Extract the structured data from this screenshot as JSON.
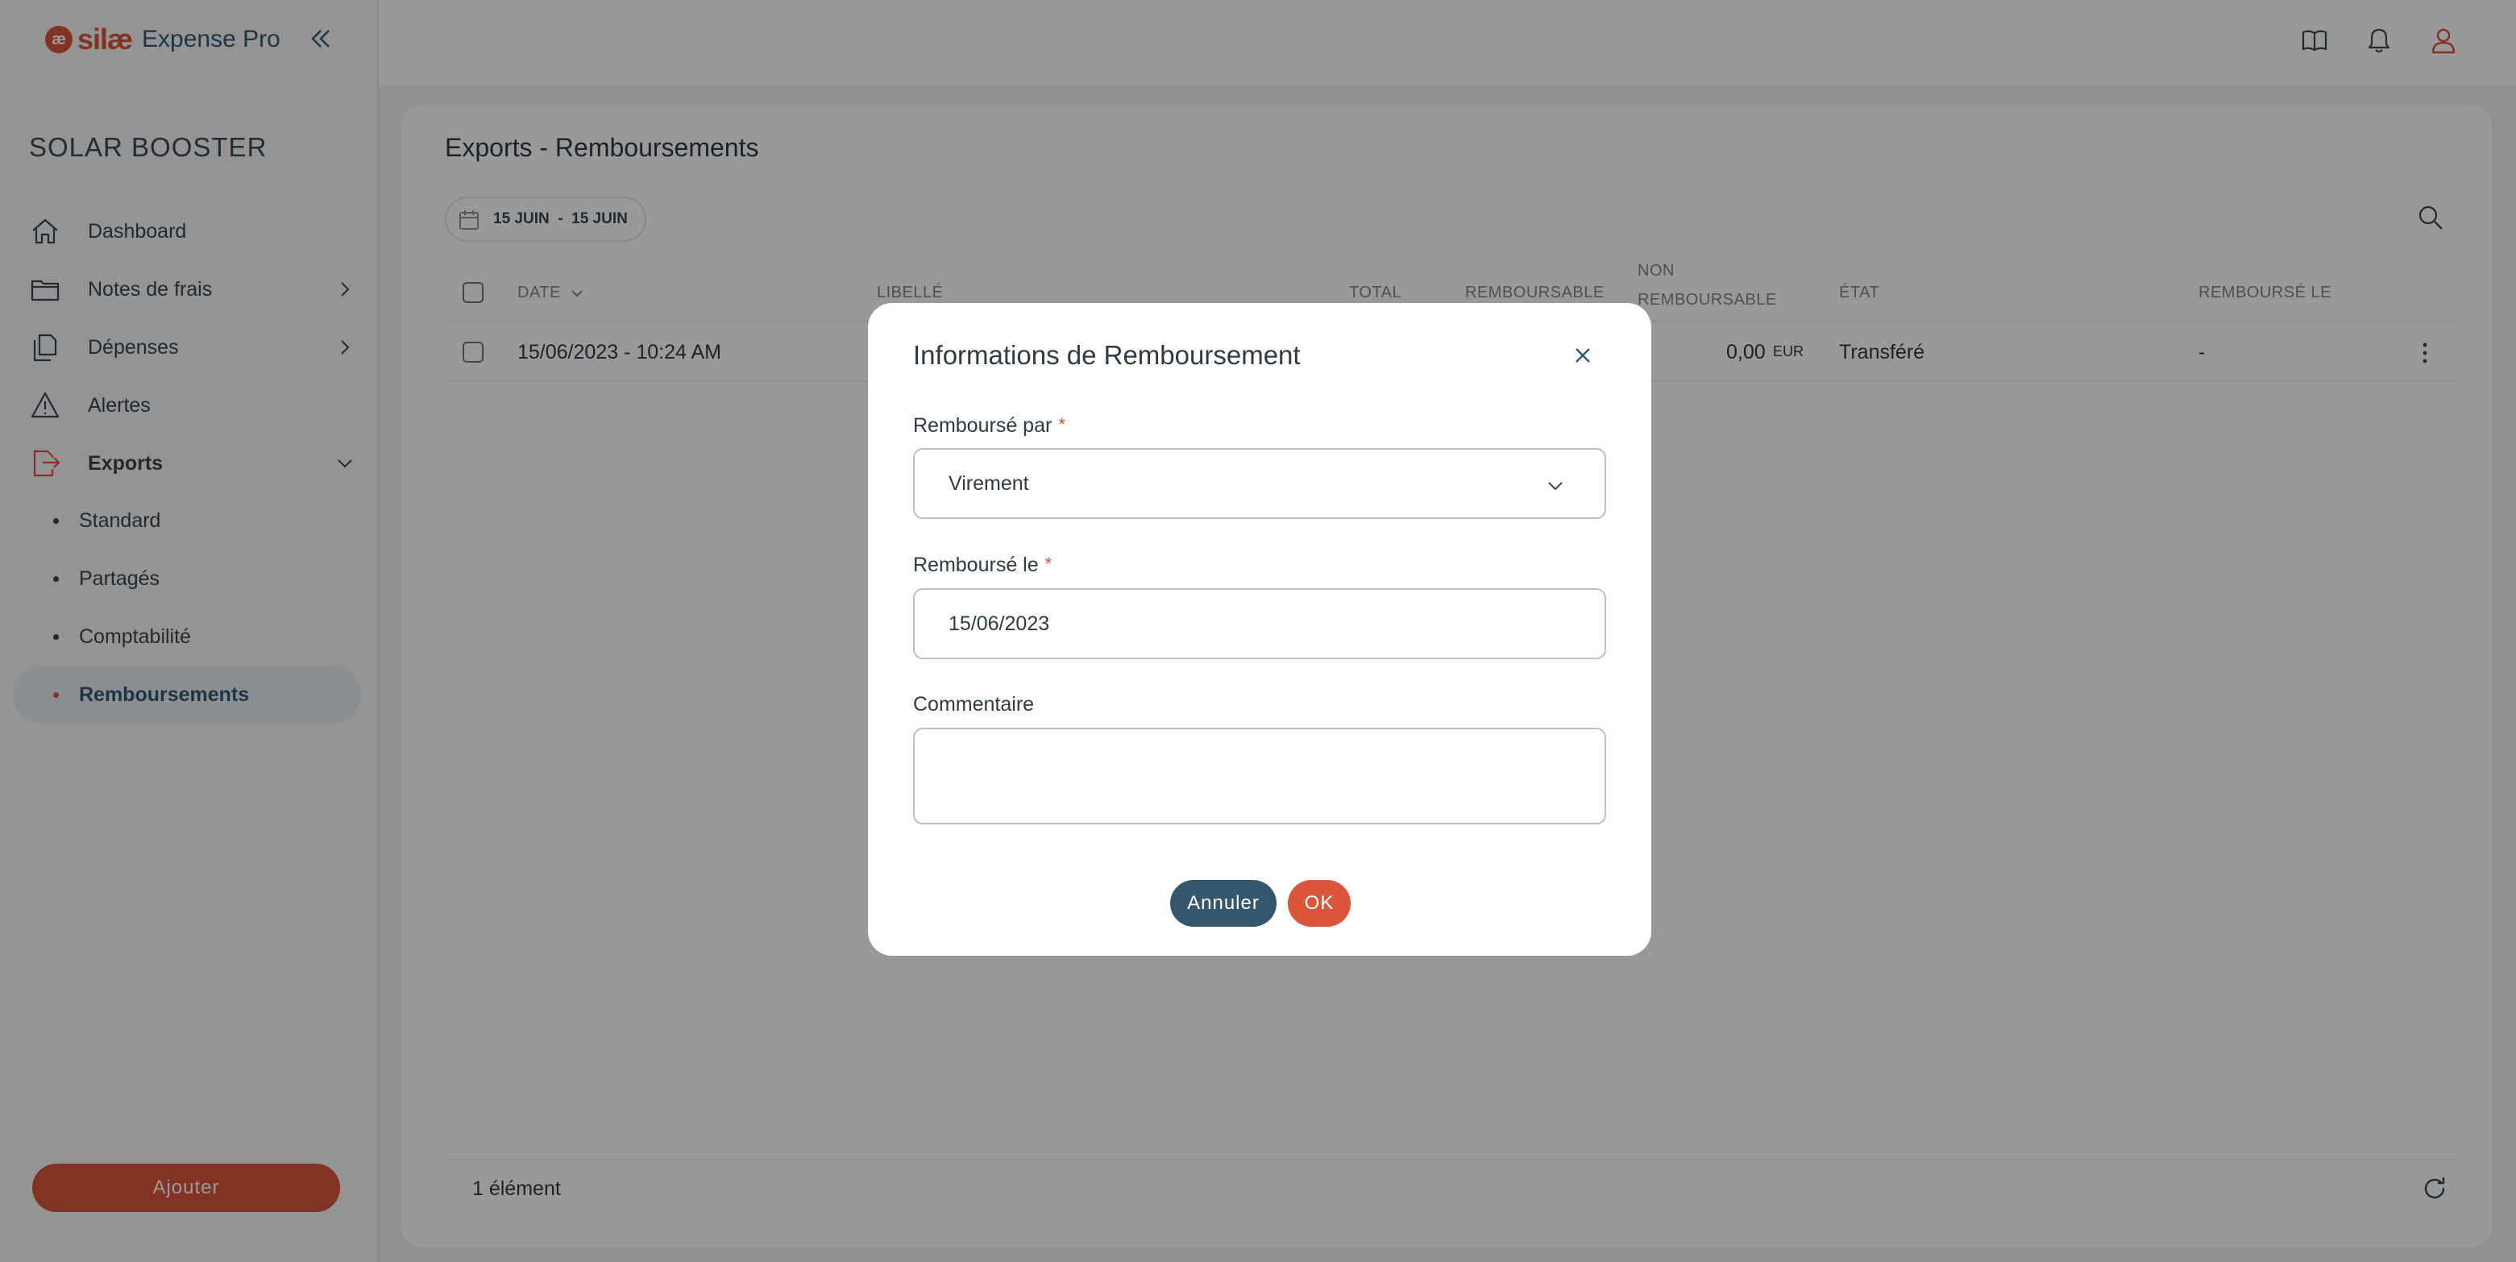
{
  "app": {
    "brand": "silæ",
    "brand_mark": "æ",
    "product": "Expense Pro",
    "company": "SOLAR BOOSTER"
  },
  "sidebar": {
    "items": [
      {
        "label": "Dashboard",
        "icon": "home-icon"
      },
      {
        "label": "Notes de frais",
        "icon": "folder-icon"
      },
      {
        "label": "Dépenses",
        "icon": "documents-icon"
      },
      {
        "label": "Alertes",
        "icon": "warning-icon"
      },
      {
        "label": "Exports",
        "icon": "export-icon"
      }
    ],
    "export_subitems": [
      {
        "label": "Standard"
      },
      {
        "label": "Partagés"
      },
      {
        "label": "Comptabilité"
      },
      {
        "label": "Remboursements"
      }
    ],
    "add_label": "Ajouter"
  },
  "page": {
    "title": "Exports - Remboursements",
    "date_filter": "15 JUIN  -  15 JUIN"
  },
  "table": {
    "headers": {
      "date": "DATE",
      "libelle": "LIBELLÉ",
      "total": "TOTAL",
      "remboursable": "REMBOURSABLE",
      "non_remboursable_1": "NON",
      "non_remboursable_2": "REMBOURSABLE",
      "etat": "ÉTAT",
      "rembourse_le": "REMBOURSÉ LE"
    },
    "rows": [
      {
        "date": "15/06/2023 - 10:24 AM",
        "non_remboursable": "0,00",
        "currency": "EUR",
        "etat": "Transféré",
        "rembourse_le": "-"
      }
    ],
    "footer_count": "1 élément"
  },
  "modal": {
    "title": "Informations de Remboursement",
    "rembourse_par_label": "Remboursé par",
    "rembourse_par_value": "Virement",
    "rembourse_le_label": "Remboursé le",
    "rembourse_le_value": "15/06/2023",
    "commentaire_label": "Commentaire",
    "commentaire_value": "",
    "required_mark": "*",
    "cancel_label": "Annuler",
    "ok_label": "OK"
  },
  "colors": {
    "accent": "#d9553b",
    "primary": "#34576e",
    "overlay": "rgba(0,0,0,0.40)"
  }
}
